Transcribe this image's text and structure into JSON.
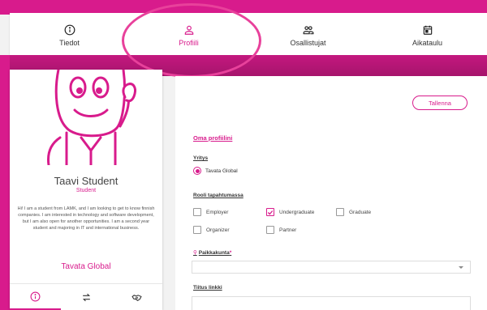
{
  "nav": {
    "items": [
      {
        "label": "Tiedot",
        "icon": "info-icon"
      },
      {
        "label": "Profiili",
        "icon": "person-icon",
        "active": true
      },
      {
        "label": "Osallistujat",
        "icon": "group-icon"
      },
      {
        "label": "Aikataulu",
        "icon": "calendar-icon"
      }
    ]
  },
  "profile_card": {
    "name": "Taavi Student",
    "role": "Student",
    "bio": "Hi! I am a student from LAMK, and I am looking to get to know finnish companies. I am interested in technology and software development, but I am also open for another opportunities. I am a second year student and majoring in IT and international business.",
    "company": "Tavata Global",
    "tabs": [
      "info-icon",
      "swap-icon",
      "handshake-icon"
    ]
  },
  "form": {
    "save_label": "Tallenna",
    "section_title": "Oma profiilini",
    "company_label": "Yritys",
    "company_value": "Tavata Global",
    "role_label": "Rooli tapahtumassa",
    "roles": [
      {
        "label": "Employer",
        "checked": false
      },
      {
        "label": "Undergraduate",
        "checked": true
      },
      {
        "label": "Graduate",
        "checked": false
      },
      {
        "label": "Organizer",
        "checked": false
      },
      {
        "label": "Partner",
        "checked": false
      }
    ],
    "city_label": "Paikkakunta",
    "city_required": "*",
    "city_value": "",
    "link_label": "Tiitus linkki",
    "link_value": ""
  },
  "colors": {
    "accent": "#d81b8c",
    "background": "#f2f2f2"
  }
}
